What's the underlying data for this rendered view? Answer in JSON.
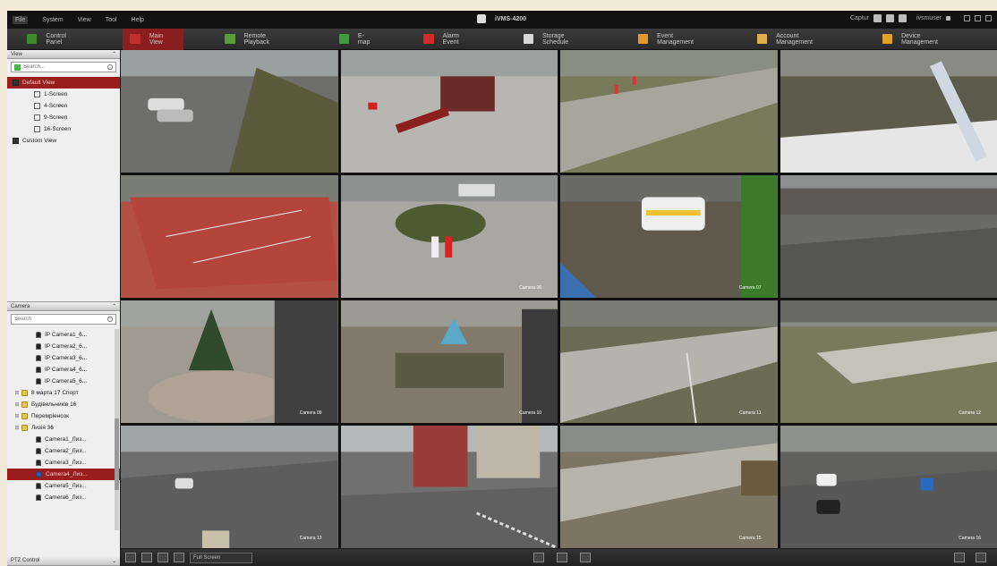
{
  "menu": [
    "File",
    "System",
    "View",
    "Tool",
    "Help"
  ],
  "app_title": "iVMS-4200",
  "titlebar_right": {
    "user_label": "Captur",
    "user_name": "ivsmuser"
  },
  "tabs": [
    {
      "label": "Control Panel",
      "icon": "control-panel-icon",
      "color": "#3f8a2f"
    },
    {
      "label": "Main View",
      "icon": "main-view-icon",
      "color": "#c0302e",
      "active": true
    },
    {
      "label": "Remote Playback",
      "icon": "playback-icon",
      "color": "#5a9a3c"
    },
    {
      "label": "E-map",
      "icon": "emap-icon",
      "color": "#3d9e3d"
    },
    {
      "label": "Alarm Event",
      "icon": "alarm-icon",
      "color": "#d22a2a"
    },
    {
      "label": "Storage Schedule",
      "icon": "storage-icon",
      "color": "#d8d8d8"
    },
    {
      "label": "Event Management",
      "icon": "event-icon",
      "color": "#e09a2a"
    },
    {
      "label": "Account Management",
      "icon": "account-icon",
      "color": "#e0b050"
    },
    {
      "label": "Device Management",
      "icon": "device-icon",
      "color": "#e0a030"
    }
  ],
  "view_panel": {
    "header": "View",
    "search_placeholder": "Search...",
    "items": [
      {
        "label": "Default View",
        "level": 0,
        "icon": "dark",
        "selected": true
      },
      {
        "label": "1-Screen",
        "level": 1,
        "icon": "screen"
      },
      {
        "label": "4-Screen",
        "level": 1,
        "icon": "screen"
      },
      {
        "label": "9-Screen",
        "level": 1,
        "icon": "screen"
      },
      {
        "label": "16-Screen",
        "level": 1,
        "icon": "screen"
      },
      {
        "label": "Custom View",
        "level": 0,
        "icon": "dark"
      }
    ]
  },
  "camera_panel": {
    "header": "Camera",
    "search_placeholder": "Search",
    "items": [
      {
        "label": "IP Camera1_6...",
        "type": "cam"
      },
      {
        "label": "IP Camera2_6...",
        "type": "cam"
      },
      {
        "label": "IP Camera3_6...",
        "type": "cam"
      },
      {
        "label": "IP Camera4_6...",
        "type": "cam"
      },
      {
        "label": "IP Camera5_6...",
        "type": "cam"
      },
      {
        "label": "8 марта 17 Спорт",
        "type": "folder"
      },
      {
        "label": "Будівельників 16",
        "type": "folder"
      },
      {
        "label": "Перемріенсок",
        "type": "folder"
      },
      {
        "label": "Лизія 36",
        "type": "folder"
      },
      {
        "label": "Camera1_Лиз...",
        "type": "cam"
      },
      {
        "label": "Camera2_Лиз...",
        "type": "cam"
      },
      {
        "label": "Camera3_Лиз...",
        "type": "cam"
      },
      {
        "label": "Camera4_Лиз...",
        "type": "blue",
        "selected": true
      },
      {
        "label": "Camera5_Лиз...",
        "type": "cam"
      },
      {
        "label": "Camera6_Лиз...",
        "type": "cam"
      }
    ]
  },
  "ptz_panel": {
    "header": "PTZ Control"
  },
  "grid": {
    "cells": [
      {
        "scene": "parking",
        "label": ""
      },
      {
        "scene": "playground",
        "label": ""
      },
      {
        "scene": "yard",
        "label": ""
      },
      {
        "scene": "snow",
        "label": ""
      },
      {
        "scene": "court",
        "label": ""
      },
      {
        "scene": "people",
        "label": "Camera 06"
      },
      {
        "scene": "police",
        "label": "Camera 07"
      },
      {
        "scene": "street",
        "label": ""
      },
      {
        "scene": "tree",
        "label": "Camera 09"
      },
      {
        "scene": "fountain",
        "label": "Camera 10"
      },
      {
        "scene": "square",
        "label": "Camera 11"
      },
      {
        "scene": "park",
        "label": "Camera 12"
      },
      {
        "scene": "road",
        "label": "Camera 13"
      },
      {
        "scene": "buildings",
        "label": ""
      },
      {
        "scene": "courtyard",
        "label": "Camera 15"
      },
      {
        "scene": "roadcars",
        "label": "Camera 16"
      }
    ]
  },
  "bottombar": {
    "stream_select": "Full Screen"
  }
}
